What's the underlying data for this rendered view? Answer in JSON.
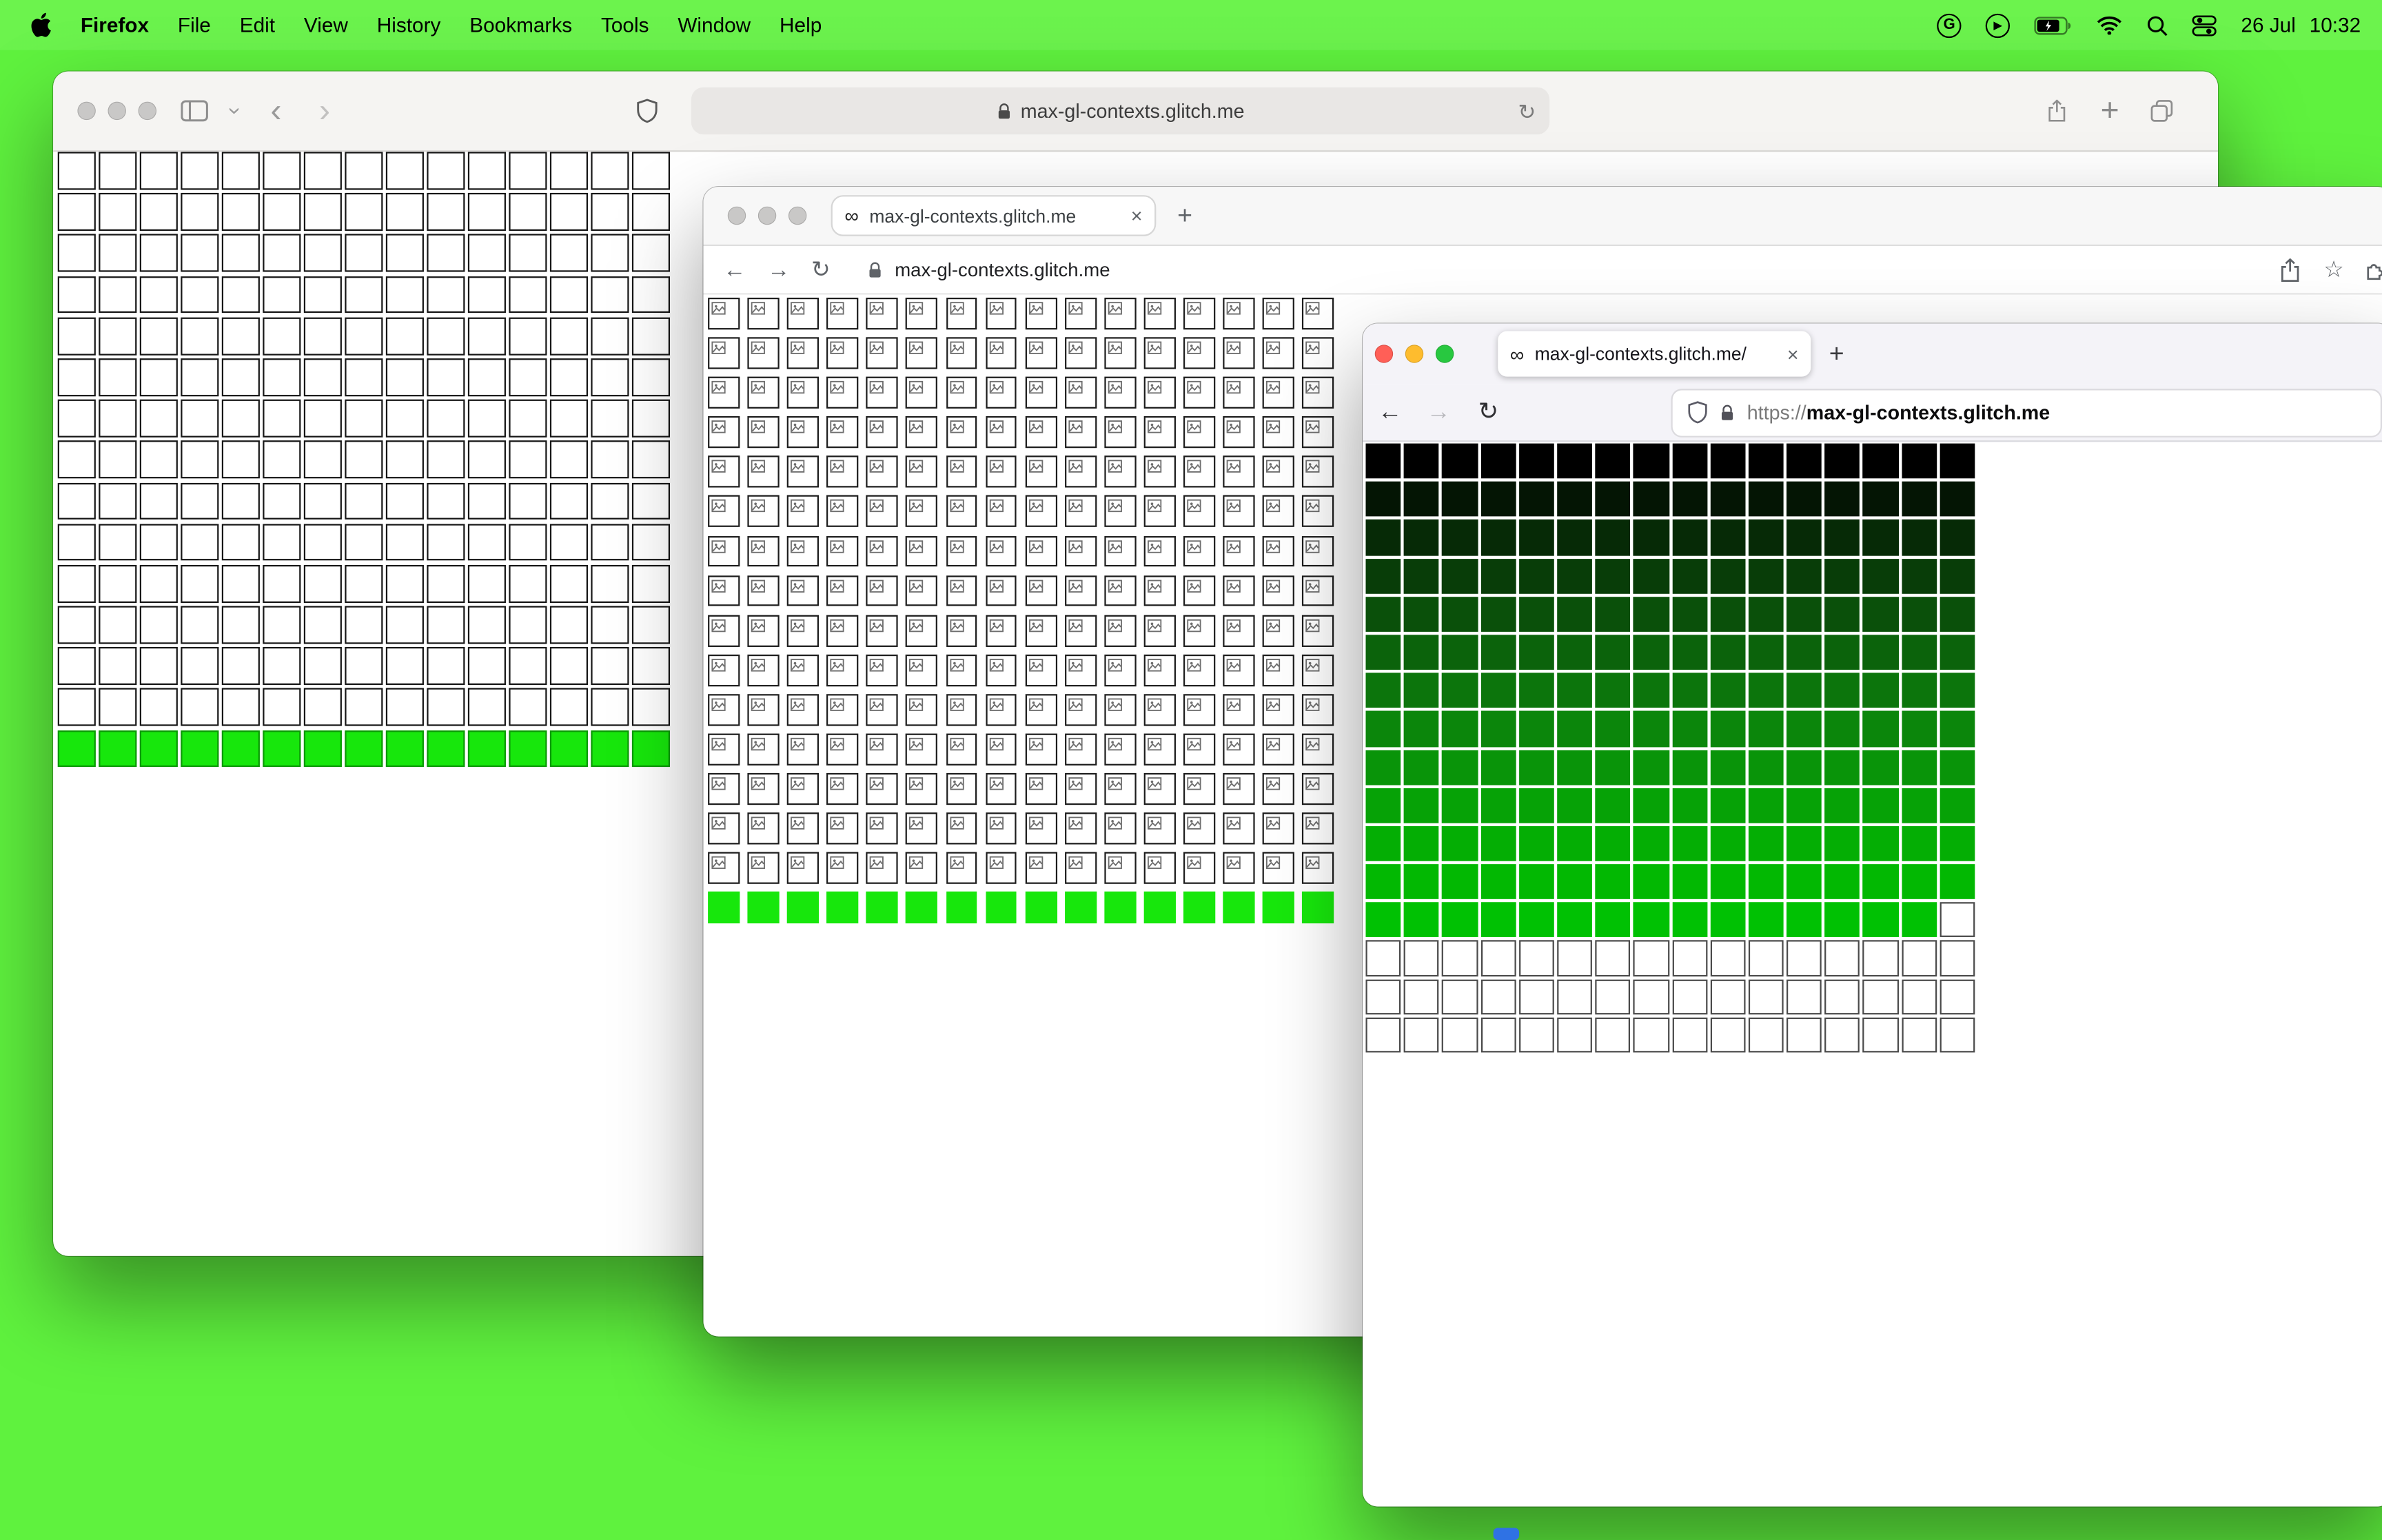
{
  "desktop": {
    "background_color": "#5ff23e",
    "dock_peek_color": "#2f72e4"
  },
  "menu_bar": {
    "app_name": "Firefox",
    "items": [
      "File",
      "Edit",
      "View",
      "History",
      "Bookmarks",
      "Tools",
      "Window",
      "Help"
    ],
    "date": "26 Jul",
    "time": "10:32",
    "status_icons": [
      "g-badge",
      "now-playing",
      "battery",
      "wifi",
      "spotlight",
      "control-center"
    ]
  },
  "glyphs": {
    "infinity": "∞",
    "close": "×",
    "plus": "+",
    "back_arrow": "←",
    "forward_arrow": "→",
    "reload": "↻",
    "back_chevron": "‹",
    "forward_chevron": "›",
    "chevron_down": "›",
    "star": "☆",
    "play": "▶",
    "g_badge": "G"
  },
  "safari_window": {
    "url": "max-gl-contexts.glitch.me",
    "grid": {
      "cols": 15,
      "rows": [
        "#ffffff",
        "#ffffff",
        "#ffffff",
        "#ffffff",
        "#ffffff",
        "#ffffff",
        "#ffffff",
        "#ffffff",
        "#ffffff",
        "#ffffff",
        "#ffffff",
        "#ffffff",
        "#ffffff",
        "#ffffff",
        "#17e70c"
      ]
    }
  },
  "chrome_window": {
    "tab_title": "max-gl-contexts.glitch.me",
    "url": "max-gl-contexts.glitch.me",
    "grid": {
      "cols": 16,
      "rows": [
        "broken",
        "broken",
        "broken",
        "broken",
        "broken",
        "broken",
        "broken",
        "broken",
        "broken",
        "broken",
        "broken",
        "broken",
        "broken",
        "broken",
        "broken",
        "#17e70c"
      ]
    }
  },
  "firefox_window": {
    "tab_title": "max-gl-contexts.glitch.me/",
    "url_scheme": "https://",
    "url_host": "max-gl-contexts.glitch.me",
    "grid": {
      "cols": 16,
      "rows": [
        "#000000",
        "#041504",
        "#062a06",
        "#083d08",
        "#0a500a",
        "#0b630b",
        "#0c750c",
        "#0b860b",
        "#099409",
        "#06a206",
        "#04ae04",
        "#02b802",
        "#00c103",
        "#ffffff",
        "#ffffff",
        "#ffffff"
      ],
      "partial_row_index": 12,
      "partial_row_filled_cells": 15
    }
  }
}
